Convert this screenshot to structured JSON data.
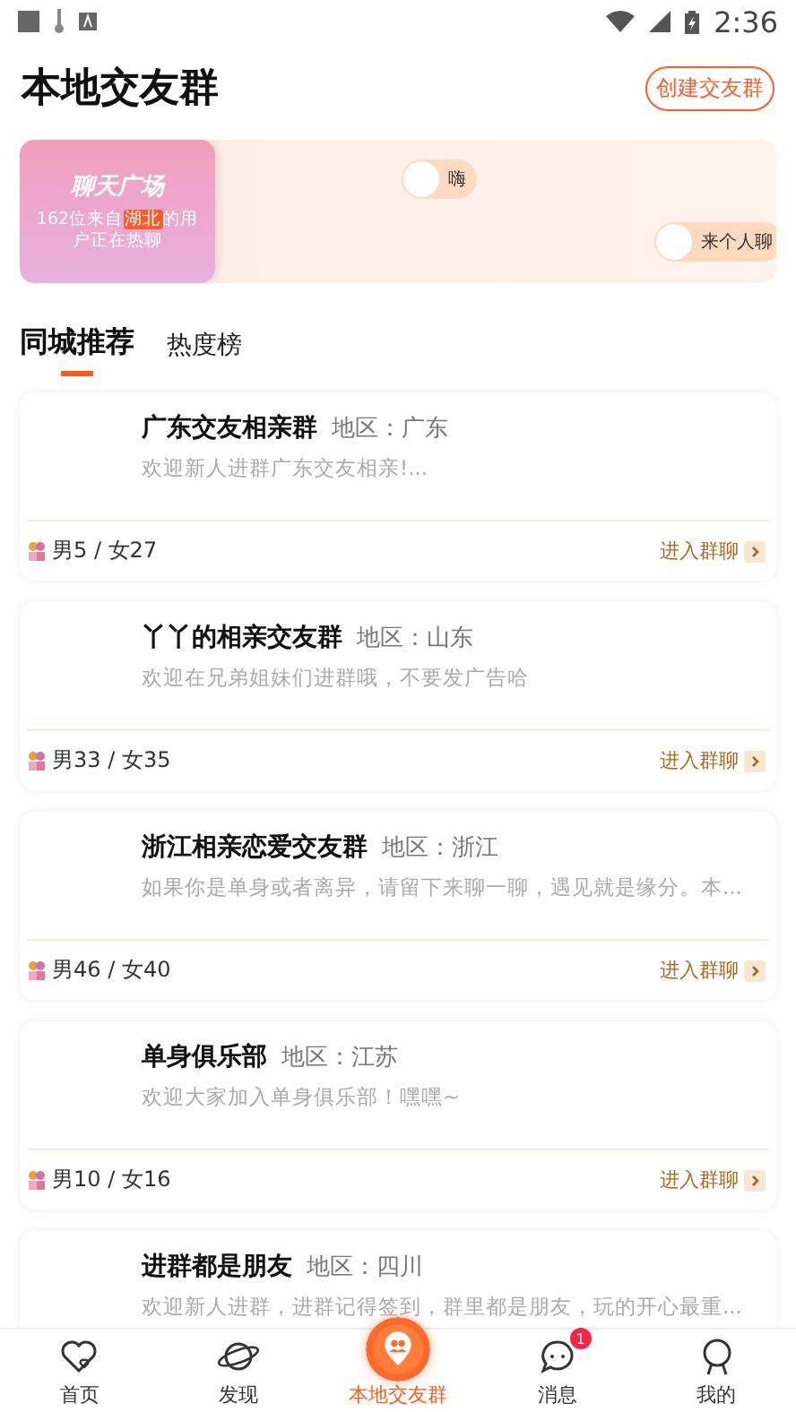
{
  "status_bar": {
    "time": "2:36"
  },
  "header": {
    "title": "本地交友群",
    "create_button": "创建交友群"
  },
  "banner": {
    "title": "聊天广场",
    "subtitle": "162位来自**湖北**的用户正在热聊",
    "bubbles": [
      "嗨",
      "来个人聊"
    ]
  },
  "tabs": [
    {
      "label": "同城推荐",
      "selected": true
    },
    {
      "label": "热度榜",
      "selected": false
    }
  ],
  "groups": [
    {
      "name": "广东交友相亲群",
      "region": "地区：广东",
      "description": "欢迎新人进群广东交友相亲!...",
      "members": "男5 / 女27",
      "enter": "进入群聊"
    },
    {
      "name": "丫丫的相亲交友群",
      "region": "地区：山东",
      "description": "欢迎在兄弟姐妹们进群哦，不要发广告哈",
      "members": "男33 / 女35",
      "enter": "进入群聊"
    },
    {
      "name": "浙江相亲恋爱交友群",
      "region": "地区：浙江",
      "description": "如果你是单身或者离异，请留下来聊一聊，遇见就是缘分。本...",
      "members": "男46 / 女40",
      "enter": "进入群聊"
    },
    {
      "name": "单身俱乐部",
      "region": "地区：江苏",
      "description": "欢迎大家加入单身俱乐部！嘿嘿~",
      "members": "男10 / 女16",
      "enter": "进入群聊"
    },
    {
      "name": "进群都是朋友",
      "region": "地区：四川",
      "description": "欢迎新人进群，进群记得签到，群里都是朋友，玩的开心最重..."
    }
  ],
  "nav": [
    {
      "label": "首页",
      "kind": "home",
      "selected": false
    },
    {
      "label": "发现",
      "kind": "discover",
      "selected": false
    },
    {
      "label": "本地交友群",
      "kind": "local",
      "selected": true
    },
    {
      "label": "消息",
      "kind": "message",
      "selected": false,
      "badge": "1"
    },
    {
      "label": "我的",
      "kind": "me",
      "selected": false
    }
  ]
}
